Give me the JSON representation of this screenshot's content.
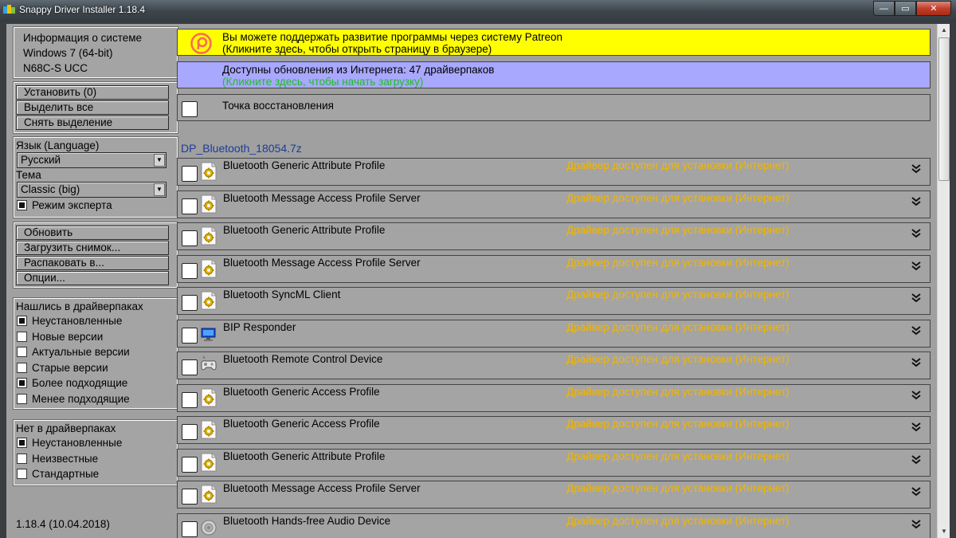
{
  "window": {
    "title": "Snappy Driver Installer 1.18.4",
    "minimize_glyph": "—",
    "maximize_glyph": "▭",
    "close_glyph": "✕"
  },
  "sysinfo": {
    "line1": "Информация о системе",
    "line2": "Windows 7 (64-bit)",
    "line3": "N68C-S UCC"
  },
  "actions": {
    "install": "Установить (0)",
    "select_all": "Выделить все",
    "deselect": "Снять выделение"
  },
  "settings": {
    "language_label": "Язык (Language)",
    "language_value": "Русский",
    "theme_label": "Тема",
    "theme_value": "Classic (big)",
    "expert_mode": "Режим эксперта",
    "expert_checked": true
  },
  "tools": {
    "refresh": "Обновить",
    "load_snapshot": "Загрузить снимок...",
    "extract_to": "Распаковать в...",
    "options": "Опции..."
  },
  "filters_found": {
    "title": "Нашлись в драйверпаках",
    "items": [
      {
        "label": "Неустановленные",
        "checked": true
      },
      {
        "label": "Новые версии",
        "checked": false
      },
      {
        "label": "Актуальные версии",
        "checked": false
      },
      {
        "label": "Старые версии",
        "checked": false
      },
      {
        "label": "Более подходящие",
        "checked": true
      },
      {
        "label": "Менее подходящие",
        "checked": false
      }
    ]
  },
  "filters_missing": {
    "title": "Нет в драйверпаках",
    "items": [
      {
        "label": "Неустановленные",
        "checked": true
      },
      {
        "label": "Неизвестные",
        "checked": false
      },
      {
        "label": "Стандартные",
        "checked": false
      }
    ]
  },
  "version": "1.18.4 (10.04.2018)",
  "banners": {
    "patreon_line1": "Вы можете поддержать развитие программы через систему Patreon",
    "patreon_line2": "(Кликните здесь, чтобы открыть страницу в браузере)",
    "update_line1": "Доступны обновления из Интернета: 47 драйверпаков",
    "update_line2": "(Кликните здесь, чтобы начать загрузку)",
    "restore_point": "Точка восстановления"
  },
  "driverpack": {
    "name": "DP_Bluetooth_18054.7z",
    "drivers": [
      {
        "name": "Bluetooth Generic Attribute Profile",
        "status": "Драйвер доступен для установки (Интернет)",
        "icon": "gear-icon"
      },
      {
        "name": "Bluetooth Message Access Profile Server",
        "status": "Драйвер доступен для установки (Интернет)",
        "icon": "gear-icon"
      },
      {
        "name": "Bluetooth Generic Attribute Profile",
        "status": "Драйвер доступен для установки (Интернет)",
        "icon": "gear-icon"
      },
      {
        "name": "Bluetooth Message Access Profile Server",
        "status": "Драйвер доступен для установки (Интернет)",
        "icon": "gear-icon"
      },
      {
        "name": "Bluetooth SyncML Client",
        "status": "Драйвер доступен для установки (Интернет)",
        "icon": "gear-icon"
      },
      {
        "name": "BIP Responder",
        "status": "Драйвер доступен для установки (Интернет)",
        "icon": "monitor-icon"
      },
      {
        "name": "Bluetooth Remote Control Device",
        "status": "Драйвер доступен для установки (Интернет)",
        "icon": "gamepad-icon"
      },
      {
        "name": "Bluetooth Generic Access Profile",
        "status": "Драйвер доступен для установки (Интернет)",
        "icon": "gear-icon"
      },
      {
        "name": "Bluetooth Generic Access Profile",
        "status": "Драйвер доступен для установки (Интернет)",
        "icon": "gear-icon"
      },
      {
        "name": "Bluetooth Generic Attribute Profile",
        "status": "Драйвер доступен для установки (Интернет)",
        "icon": "gear-icon"
      },
      {
        "name": "Bluetooth Message Access Profile Server",
        "status": "Драйвер доступен для установки (Интернет)",
        "icon": "gear-icon"
      },
      {
        "name": "Bluetooth Hands-free Audio Device",
        "status": "Драйвер доступен для установки (Интернет)",
        "icon": "speaker-icon"
      }
    ]
  },
  "colors": {
    "patreon_banner": "#ffff00",
    "update_banner": "#a8a8ff",
    "status_text": "#f2b600",
    "update_hint": "#1fbf1f",
    "pack_title": "#1a3c9c",
    "patreon_brand": "#f96854"
  }
}
